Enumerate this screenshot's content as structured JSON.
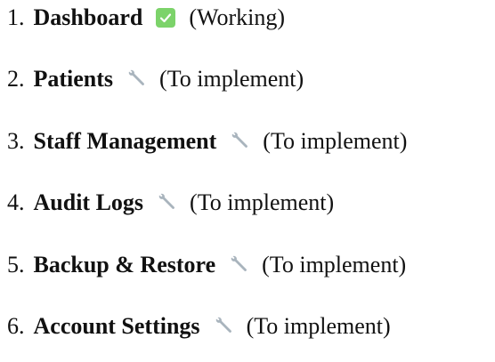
{
  "items": [
    {
      "number": "1.",
      "name": "Dashboard",
      "icon": "check-mark-icon",
      "status": "(Working)"
    },
    {
      "number": "2.",
      "name": "Patients",
      "icon": "wrench-icon",
      "status": "(To implement)"
    },
    {
      "number": "3.",
      "name": "Staff Management",
      "icon": "wrench-icon",
      "status": "(To implement)"
    },
    {
      "number": "4.",
      "name": "Audit Logs",
      "icon": "wrench-icon",
      "status": "(To implement)"
    },
    {
      "number": "5.",
      "name": "Backup & Restore",
      "icon": "wrench-icon",
      "status": "(To implement)"
    },
    {
      "number": "6.",
      "name": "Account Settings",
      "icon": "wrench-icon",
      "status": "(To implement)"
    }
  ],
  "colors": {
    "check_background": "#7cd36a",
    "wrench": "#a9b4bd"
  }
}
